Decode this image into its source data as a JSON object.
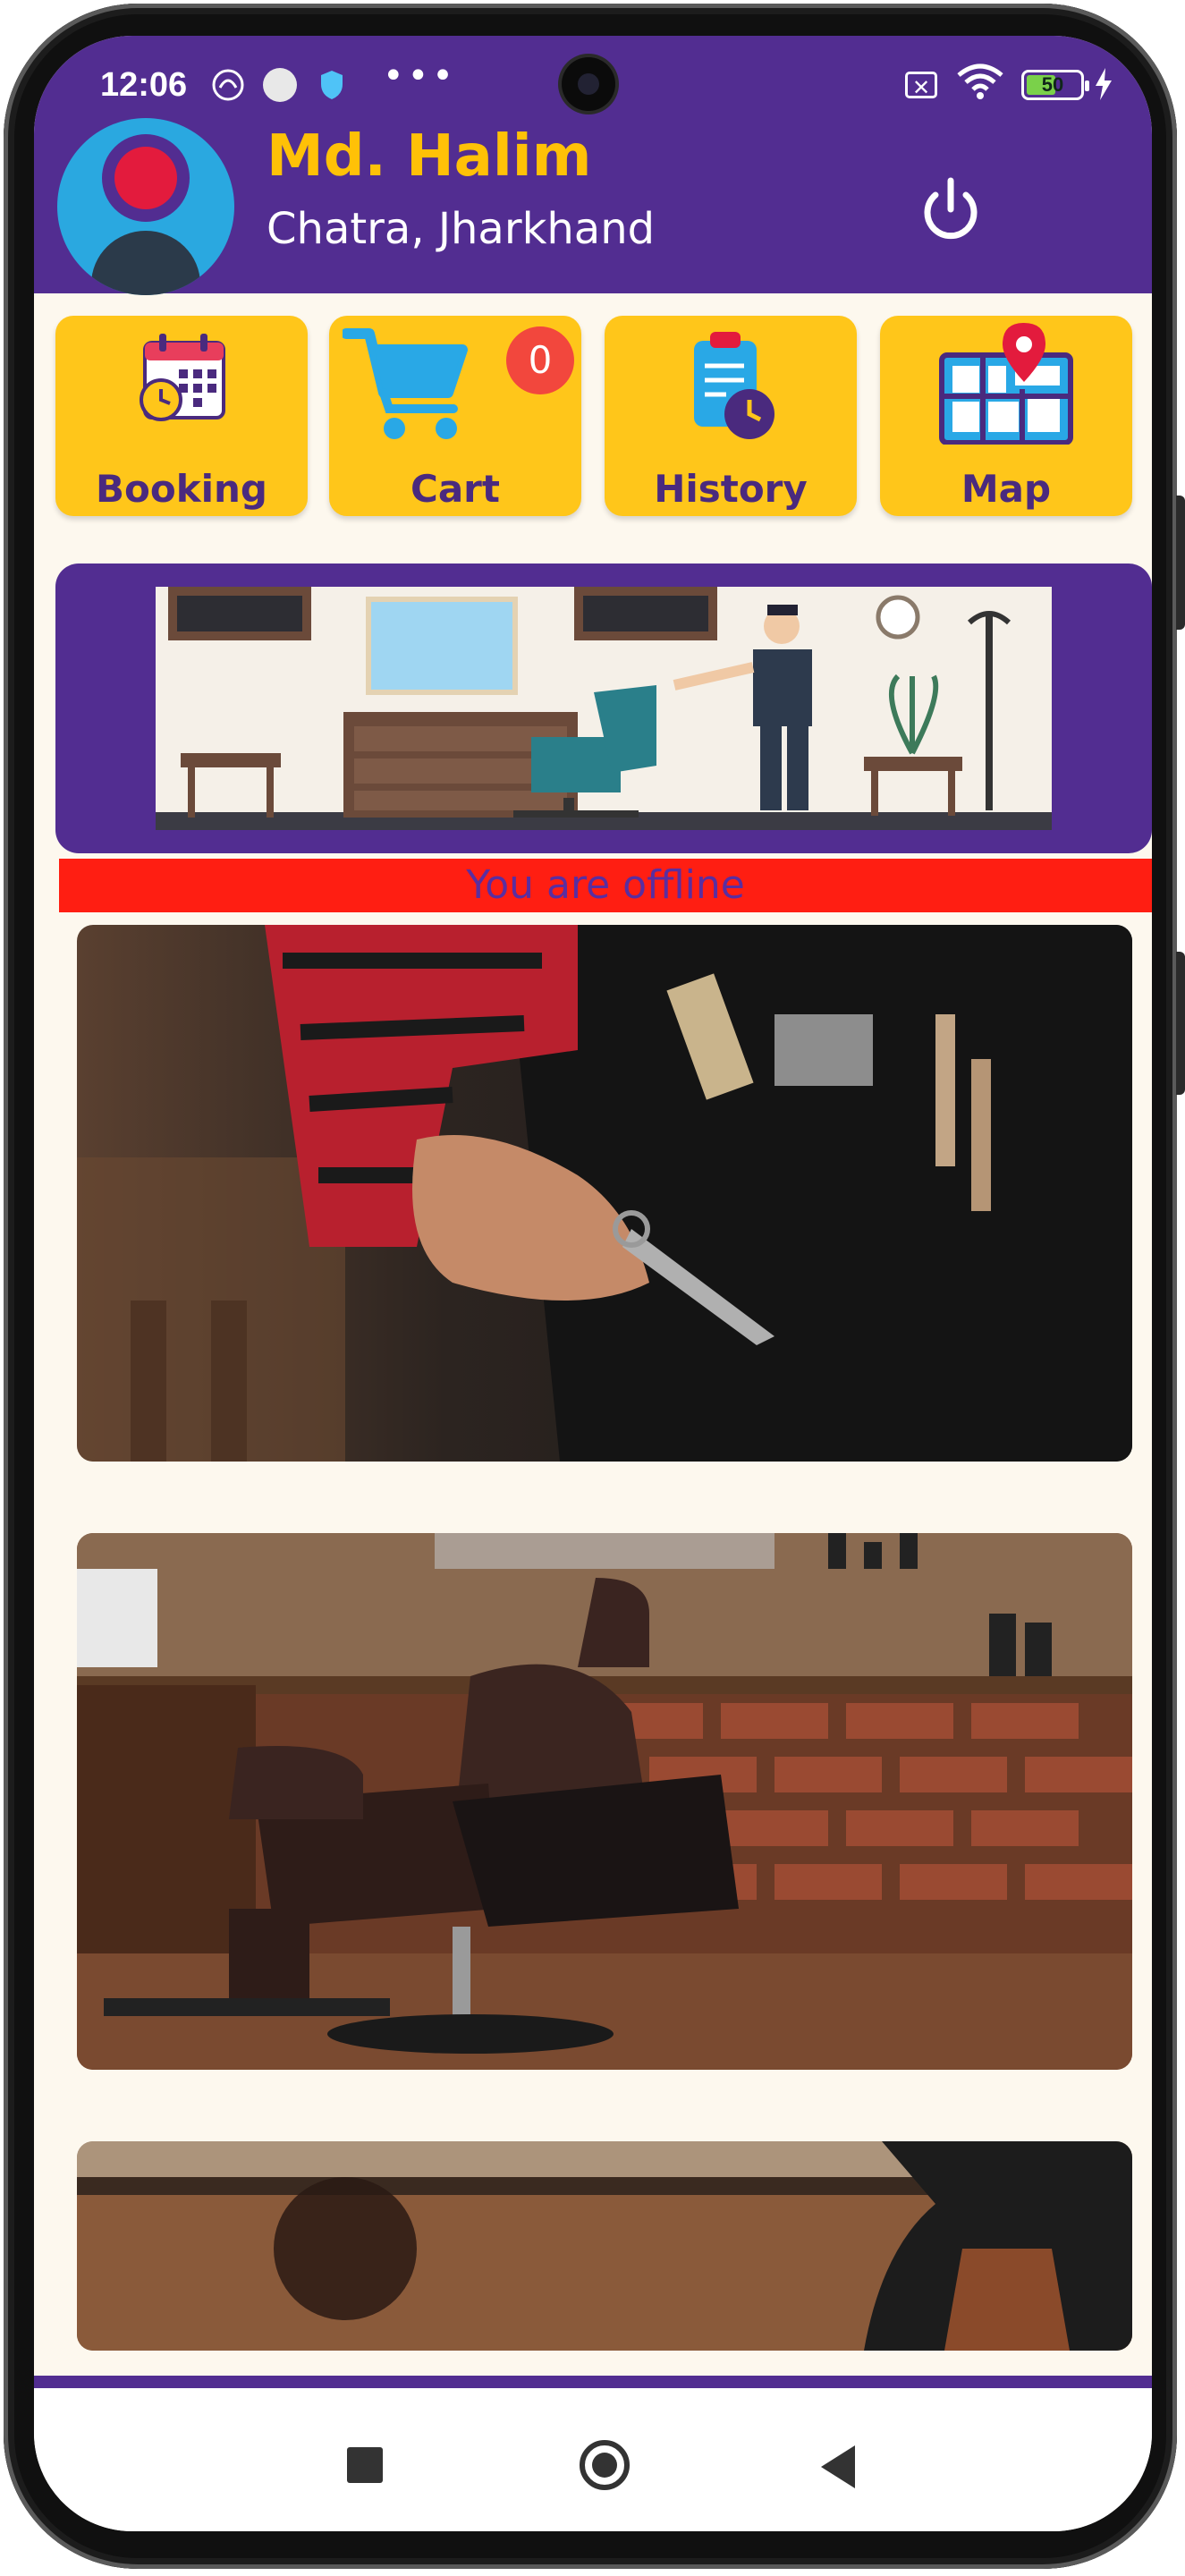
{
  "status_bar": {
    "time": "12:06",
    "battery": "50"
  },
  "user": {
    "name": "Md. Halim",
    "location": "Chatra, Jharkhand"
  },
  "menu": [
    {
      "label": "Booking",
      "icon": "calendar-clock-icon"
    },
    {
      "label": "Cart",
      "icon": "cart-icon",
      "badge": "0"
    },
    {
      "label": "History",
      "icon": "clipboard-clock-icon"
    },
    {
      "label": "Map",
      "icon": "map-pin-icon"
    }
  ],
  "offline_message": "You are offline",
  "colors": {
    "primary": "#522d91",
    "accent": "#ffc61a",
    "alert": "#ff1e12"
  }
}
